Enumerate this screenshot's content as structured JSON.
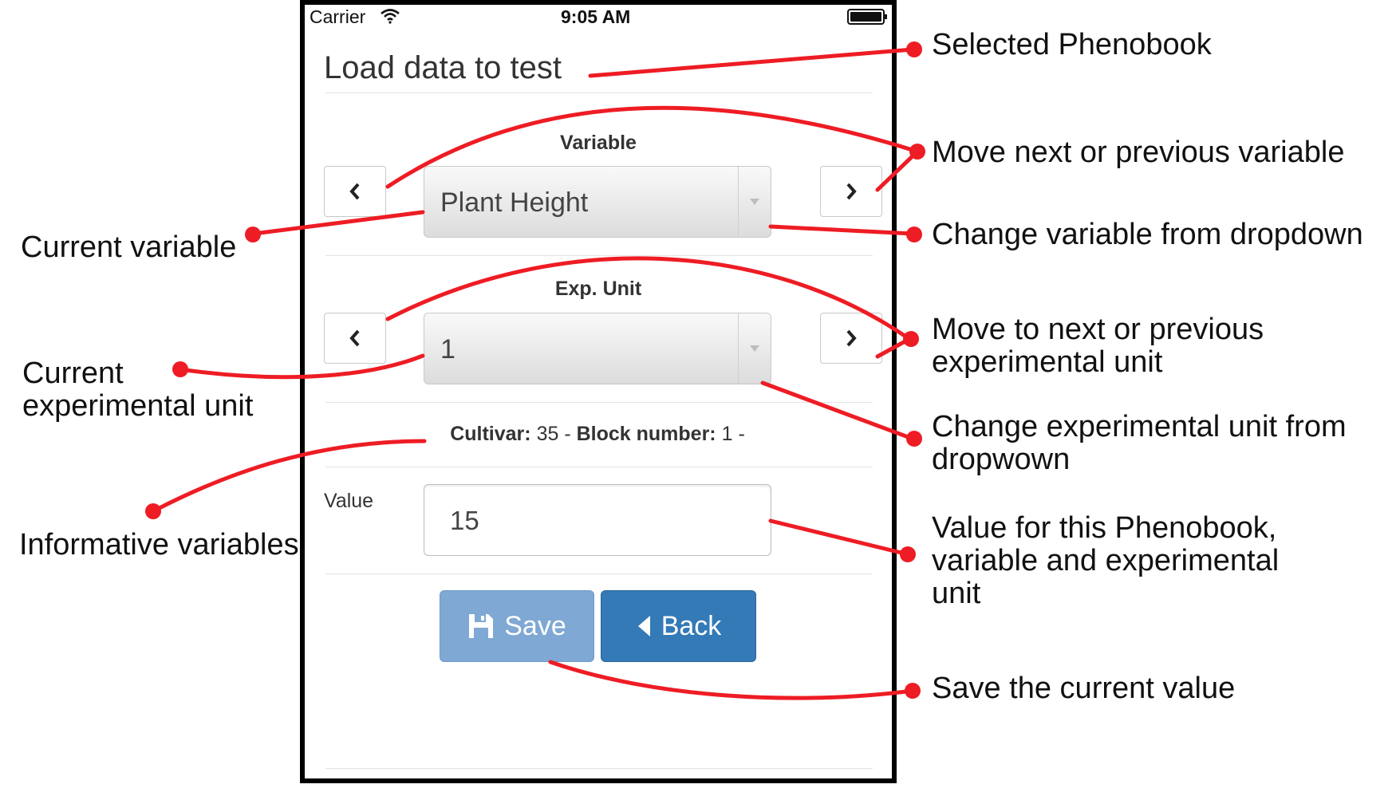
{
  "status_bar": {
    "carrier": "Carrier",
    "time": "9:05 AM"
  },
  "page": {
    "title": "Load data to test"
  },
  "variable": {
    "label": "Variable",
    "selected": "Plant Height"
  },
  "exp_unit": {
    "label": "Exp. Unit",
    "selected": "1"
  },
  "info": {
    "cultivar_label": "Cultivar:",
    "cultivar_value": "35",
    "sep": "-",
    "block_label": "Block number:",
    "block_value": "1",
    "trail": "-"
  },
  "value_field": {
    "label": "Value",
    "value": "15"
  },
  "buttons": {
    "save": "Save",
    "back": "Back"
  },
  "annotations": {
    "selected_phenobook": "Selected Phenobook",
    "move_variable": "Move next or previous variable",
    "current_variable": "Current variable",
    "change_variable": "Change variable from dropdown",
    "move_unit_line1": "Move to next or previous",
    "move_unit_line2": "experimental unit",
    "current_unit_line1": "Current",
    "current_unit_line2": "experimental unit",
    "change_unit_line1": "Change experimental unit from",
    "change_unit_line2": "dropwown",
    "informative": "Informative variables",
    "value_line1": "Value for this Phenobook,",
    "value_line2": "variable and experimental",
    "value_line3": "unit",
    "save_current": "Save the current value"
  },
  "colors": {
    "annotation_red": "#ee1c24",
    "save_btn": "#7fa8d4",
    "back_btn": "#337ab7"
  },
  "icons": [
    "wifi-icon",
    "battery-icon",
    "chevron-left-icon",
    "chevron-right-icon",
    "dropdown-caret-icon",
    "floppy-disk-icon",
    "caret-left-icon"
  ]
}
